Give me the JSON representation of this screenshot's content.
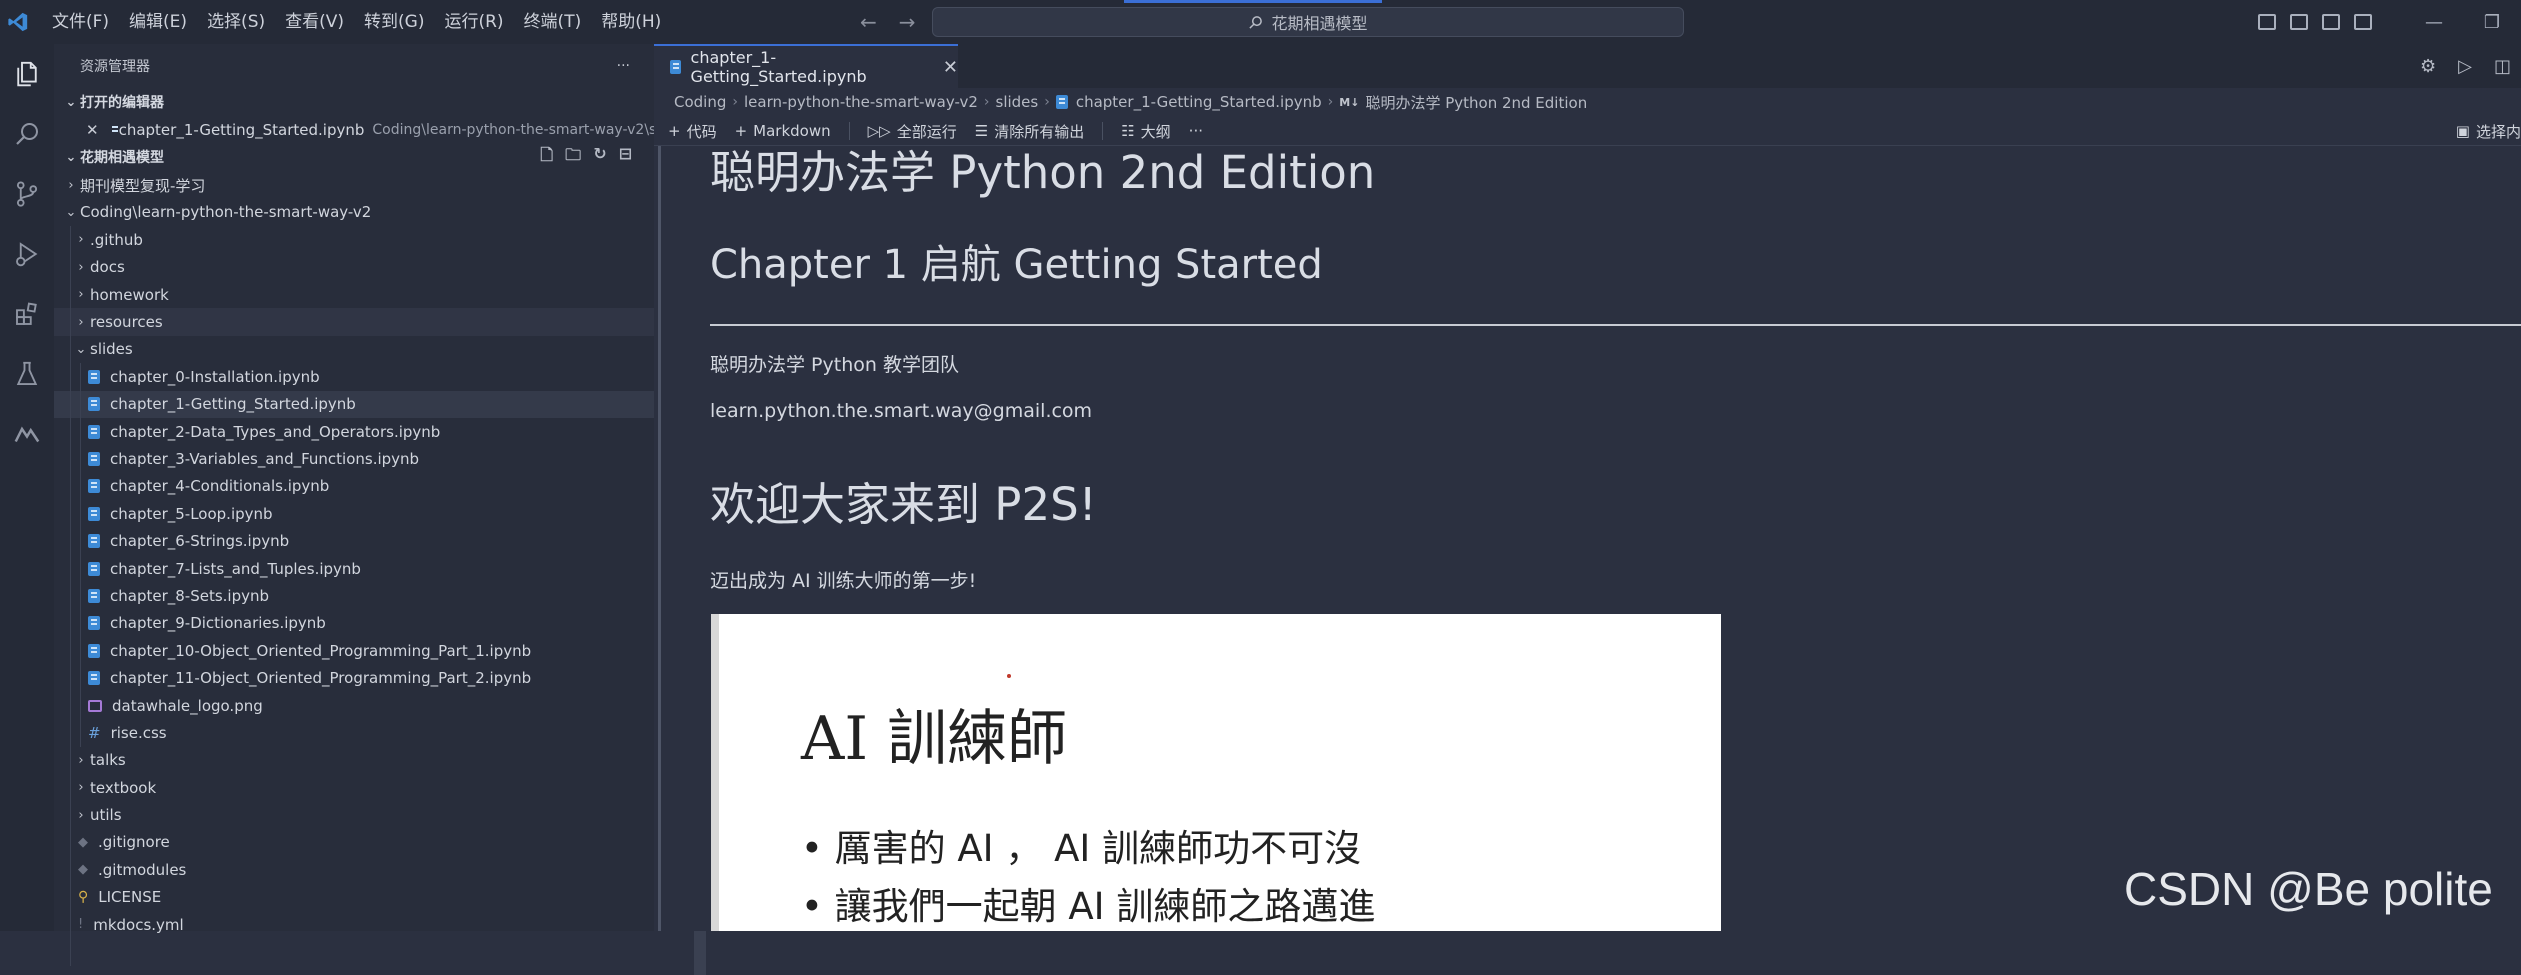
{
  "menu": [
    "文件(F)",
    "编辑(E)",
    "选择(S)",
    "查看(V)",
    "转到(G)",
    "运行(R)",
    "终端(T)",
    "帮助(H)"
  ],
  "search": {
    "text": "花期相遇模型"
  },
  "sidebar": {
    "title": "资源管理器",
    "open_editors_title": "打开的编辑器",
    "open_editor": {
      "name": "chapter_1-Getting_Started.ipynb",
      "desc": "Coding\\learn-python-the-smart-way-v2\\s..."
    },
    "workspace_title": "花期相遇模型",
    "tree": [
      {
        "label": "期刊模型复现-学习",
        "type": "folder",
        "depth": 0,
        "open": false
      },
      {
        "label": "Coding\\learn-python-the-smart-way-v2",
        "type": "folder",
        "depth": 0,
        "open": true
      },
      {
        "label": ".github",
        "type": "folder",
        "depth": 1,
        "open": false
      },
      {
        "label": "docs",
        "type": "folder",
        "depth": 1,
        "open": false
      },
      {
        "label": "homework",
        "type": "folder",
        "depth": 1,
        "open": false
      },
      {
        "label": "resources",
        "type": "folder",
        "depth": 1,
        "open": false
      },
      {
        "label": "slides",
        "type": "folder",
        "depth": 1,
        "open": true
      },
      {
        "label": "chapter_0-Installation.ipynb",
        "type": "nb",
        "depth": 2
      },
      {
        "label": "chapter_1-Getting_Started.ipynb",
        "type": "nb",
        "depth": 2
      },
      {
        "label": "chapter_2-Data_Types_and_Operators.ipynb",
        "type": "nb",
        "depth": 2
      },
      {
        "label": "chapter_3-Variables_and_Functions.ipynb",
        "type": "nb",
        "depth": 2
      },
      {
        "label": "chapter_4-Conditionals.ipynb",
        "type": "nb",
        "depth": 2
      },
      {
        "label": "chapter_5-Loop.ipynb",
        "type": "nb",
        "depth": 2
      },
      {
        "label": "chapter_6-Strings.ipynb",
        "type": "nb",
        "depth": 2
      },
      {
        "label": "chapter_7-Lists_and_Tuples.ipynb",
        "type": "nb",
        "depth": 2
      },
      {
        "label": "chapter_8-Sets.ipynb",
        "type": "nb",
        "depth": 2
      },
      {
        "label": "chapter_9-Dictionaries.ipynb",
        "type": "nb",
        "depth": 2
      },
      {
        "label": "chapter_10-Object_Oriented_Programming_Part_1.ipynb",
        "type": "nb",
        "depth": 2
      },
      {
        "label": "chapter_11-Object_Oriented_Programming_Part_2.ipynb",
        "type": "nb",
        "depth": 2
      },
      {
        "label": "datawhale_logo.png",
        "type": "img",
        "depth": 2
      },
      {
        "label": "rise.css",
        "type": "css",
        "depth": 2
      },
      {
        "label": "talks",
        "type": "folder",
        "depth": 1,
        "open": false
      },
      {
        "label": "textbook",
        "type": "folder",
        "depth": 1,
        "open": false
      },
      {
        "label": "utils",
        "type": "folder",
        "depth": 1,
        "open": false
      },
      {
        "label": ".gitignore",
        "type": "git",
        "depth": 1
      },
      {
        "label": ".gitmodules",
        "type": "git",
        "depth": 1
      },
      {
        "label": "LICENSE",
        "type": "license",
        "depth": 1
      },
      {
        "label": "mkdocs.yml",
        "type": "yml",
        "depth": 1
      }
    ]
  },
  "tab": {
    "label": "chapter_1-Getting_Started.ipynb"
  },
  "breadcrumb": [
    "Coding",
    "learn-python-the-smart-way-v2",
    "slides",
    "chapter_1-Getting_Started.ipynb",
    "聪明办法学 Python 2nd Edition"
  ],
  "breadcrumb_badge": "M↓",
  "toolbar": {
    "code": "代码",
    "markdown": "Markdown",
    "run_all": "全部运行",
    "clear_outputs": "清除所有输出",
    "outline": "大纲",
    "more": "···",
    "select_kernel": "选择内"
  },
  "notebook": {
    "h1": "聪明办法学 Python 2nd Edition",
    "h2": "Chapter 1 启航 Getting Started",
    "team": "聪明办法学 Python 教学团队",
    "email": "learn.python.the.smart.way@gmail.com",
    "welcome": "欢迎大家来到 P2S!",
    "first_step": "迈出成为 AI 训练大师的第一步!",
    "slide": {
      "title": "AI 訓練師",
      "bullet1": "• 厲害的 AI ， AI 訓練師功不可沒",
      "bullet2": "• 讓我們一起朝 AI 訓練師之路邁進"
    }
  },
  "watermark": "CSDN @Be  polite",
  "colors": {
    "accent": "#3b6fd6",
    "notebook_icon": "#3d8ad6",
    "background": "#2b3040"
  }
}
